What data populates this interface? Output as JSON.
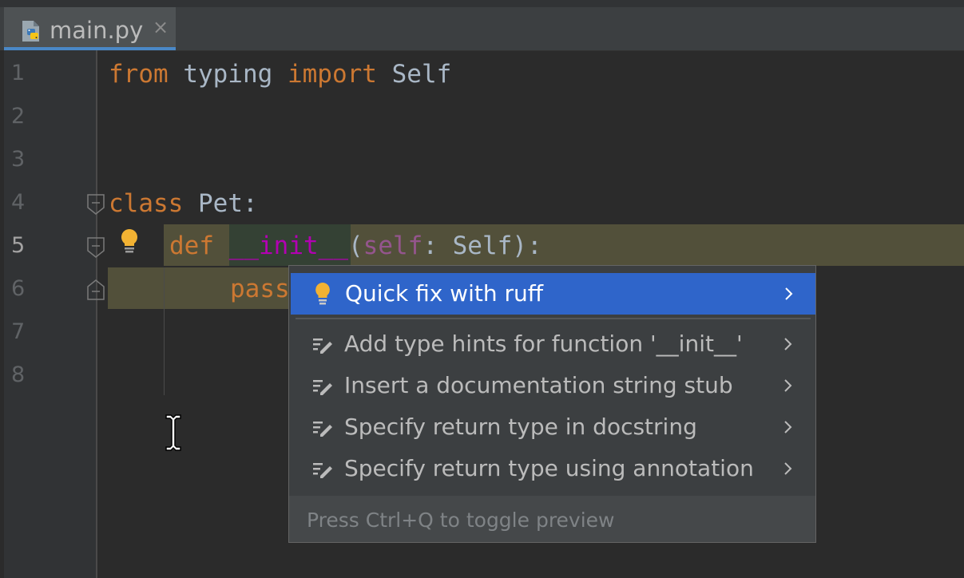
{
  "tab": {
    "filename": "main.py",
    "close_glyph": "×",
    "icon": "python-file-icon"
  },
  "gutter": {
    "line_numbers": [
      "1",
      "2",
      "3",
      "4",
      "5",
      "6",
      "7",
      "8"
    ],
    "current_line": "5"
  },
  "code": {
    "line1": {
      "kw1": "from",
      "mod": " typing ",
      "kw2": "import",
      "name": " Self"
    },
    "line4": {
      "kw": "class",
      "rest": " Pet:"
    },
    "line5": {
      "kw": "def",
      "sp": " ",
      "fn": "__init__",
      "open": "(",
      "self": "self",
      "rest": ": Self):"
    },
    "line6": {
      "kw": "pass"
    }
  },
  "intention_popup": {
    "items": [
      {
        "label": "Quick fix with ruff",
        "icon": "lightbulb-icon",
        "selected": true
      },
      {
        "label": "Add type hints for function '__init__'",
        "icon": "edit-intention-icon"
      },
      {
        "label": "Insert a documentation string stub",
        "icon": "edit-intention-icon"
      },
      {
        "label": "Specify return type in docstring",
        "icon": "edit-intention-icon"
      },
      {
        "label": "Specify return type using annotation",
        "icon": "edit-intention-icon"
      }
    ],
    "footer_hint": "Press Ctrl+Q to toggle preview"
  },
  "colors": {
    "background": "#2b2b2b",
    "keyword": "#cc7832",
    "self": "#94558d",
    "dunder": "#b200b2",
    "identifier": "#a9b7c6",
    "selection": "#2f65ca",
    "bulb": "#f2b233"
  }
}
